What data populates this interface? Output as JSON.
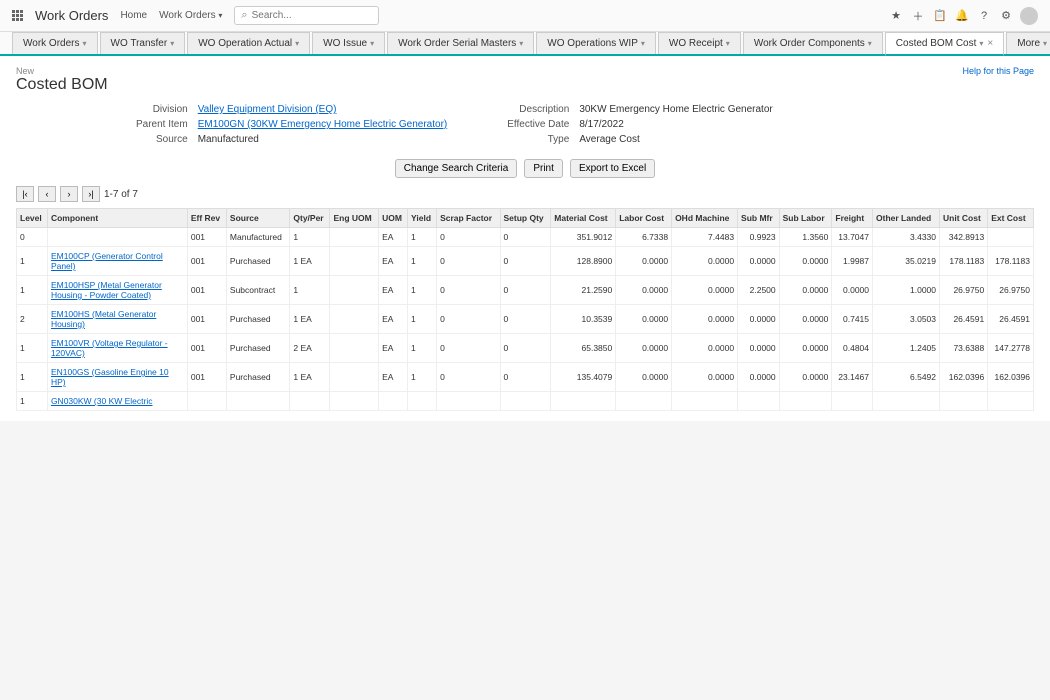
{
  "header": {
    "app_title": "Work Orders",
    "home": "Home",
    "search_placeholder": "Search..."
  },
  "tabs": [
    {
      "label": "Work Orders"
    },
    {
      "label": "WO Transfer"
    },
    {
      "label": "WO Operation Actual"
    },
    {
      "label": "WO Issue"
    },
    {
      "label": "Work Order Serial Masters"
    },
    {
      "label": "WO Operations WIP"
    },
    {
      "label": "WO Receipt"
    },
    {
      "label": "Work Order Components"
    },
    {
      "label": "Costed BOM Cost",
      "active": true
    },
    {
      "label": "More"
    }
  ],
  "page": {
    "breadcrumb": "New",
    "title": "Costed BOM",
    "help": "Help for this Page"
  },
  "info_left": {
    "division_label": "Division",
    "division_value": "Valley Equipment Division (EQ)",
    "parent_label": "Parent Item",
    "parent_value": "EM100GN (30KW Emergency Home Electric Generator)",
    "source_label": "Source",
    "source_value": "Manufactured"
  },
  "info_right": {
    "desc_label": "Description",
    "desc_value": "30KW Emergency Home Electric Generator",
    "eff_label": "Effective Date",
    "eff_value": "8/17/2022",
    "type_label": "Type",
    "type_value": "Average Cost"
  },
  "actions": {
    "change": "Change Search Criteria",
    "print": "Print",
    "export": "Export to Excel"
  },
  "pager": {
    "range": "1-7 of 7"
  },
  "columns": [
    "Level",
    "Component",
    "Eff Rev",
    "Source",
    "Qty/Per",
    "Eng UOM",
    "UOM",
    "Yield",
    "Scrap Factor",
    "Setup Qty",
    "Material Cost",
    "Labor Cost",
    "OHd Machine",
    "Sub Mfr",
    "Sub Labor",
    "Freight",
    "Other Landed",
    "Unit Cost",
    "Ext Cost"
  ],
  "rows": [
    {
      "level": "0",
      "component": "",
      "eff": "001",
      "source": "Manufactured",
      "qty": "1",
      "eng": "",
      "uom": "EA",
      "yield": "1",
      "scrap": "0",
      "setup": "0",
      "mat": "351.9012",
      "lab": "6.7338",
      "ohd": "7.4483",
      "sub": "0.9923",
      "sublab": "1.3560",
      "freight": "13.7047",
      "other": "3.4330",
      "unit": "342.8913",
      "ext": ""
    },
    {
      "level": "1",
      "component": "EM100CP (Generator Control Panel)",
      "eff": "001",
      "source": "Purchased",
      "qty": "1 EA",
      "eng": "",
      "uom": "EA",
      "yield": "1",
      "scrap": "0",
      "setup": "0",
      "mat": "128.8900",
      "lab": "0.0000",
      "ohd": "0.0000",
      "sub": "0.0000",
      "sublab": "0.0000",
      "freight": "1.9987",
      "other": "35.0219",
      "unit": "178.1183",
      "ext": "178.1183"
    },
    {
      "level": "1",
      "component": "EM100HSP (Metal Generator Housing - Powder Coated)",
      "eff": "001",
      "source": "Subcontract",
      "qty": "1",
      "eng": "",
      "uom": "EA",
      "yield": "1",
      "scrap": "0",
      "setup": "0",
      "mat": "21.2590",
      "lab": "0.0000",
      "ohd": "0.0000",
      "sub": "2.2500",
      "sublab": "0.0000",
      "freight": "0.0000",
      "other": "1.0000",
      "unit": "26.9750",
      "ext": "26.9750"
    },
    {
      "level": "2",
      "component": "EM100HS (Metal Generator Housing)",
      "eff": "001",
      "source": "Purchased",
      "qty": "1 EA",
      "eng": "",
      "uom": "EA",
      "yield": "1",
      "scrap": "0",
      "setup": "0",
      "mat": "10.3539",
      "lab": "0.0000",
      "ohd": "0.0000",
      "sub": "0.0000",
      "sublab": "0.0000",
      "freight": "0.7415",
      "other": "3.0503",
      "unit": "26.4591",
      "ext": "26.4591"
    },
    {
      "level": "1",
      "component": "EM100VR (Voltage Regulator - 120VAC)",
      "eff": "001",
      "source": "Purchased",
      "qty": "2 EA",
      "eng": "",
      "uom": "EA",
      "yield": "1",
      "scrap": "0",
      "setup": "0",
      "mat": "65.3850",
      "lab": "0.0000",
      "ohd": "0.0000",
      "sub": "0.0000",
      "sublab": "0.0000",
      "freight": "0.4804",
      "other": "1.2405",
      "unit": "73.6388",
      "ext": "147.2778"
    },
    {
      "level": "1",
      "component": "EN100GS (Gasoline Engine 10 HP)",
      "eff": "001",
      "source": "Purchased",
      "qty": "1 EA",
      "eng": "",
      "uom": "EA",
      "yield": "1",
      "scrap": "0",
      "setup": "0",
      "mat": "135.4079",
      "lab": "0.0000",
      "ohd": "0.0000",
      "sub": "0.0000",
      "sublab": "0.0000",
      "freight": "23.1467",
      "other": "6.5492",
      "unit": "162.0396",
      "ext": "162.0396"
    },
    {
      "level": "1",
      "component": "GN030KW (30 KW Electric",
      "eff": "",
      "source": "",
      "qty": "",
      "eng": "",
      "uom": "",
      "yield": "",
      "scrap": "",
      "setup": "",
      "mat": "",
      "lab": "",
      "ohd": "",
      "sub": "",
      "sublab": "",
      "freight": "",
      "other": "",
      "unit": "",
      "ext": ""
    }
  ]
}
